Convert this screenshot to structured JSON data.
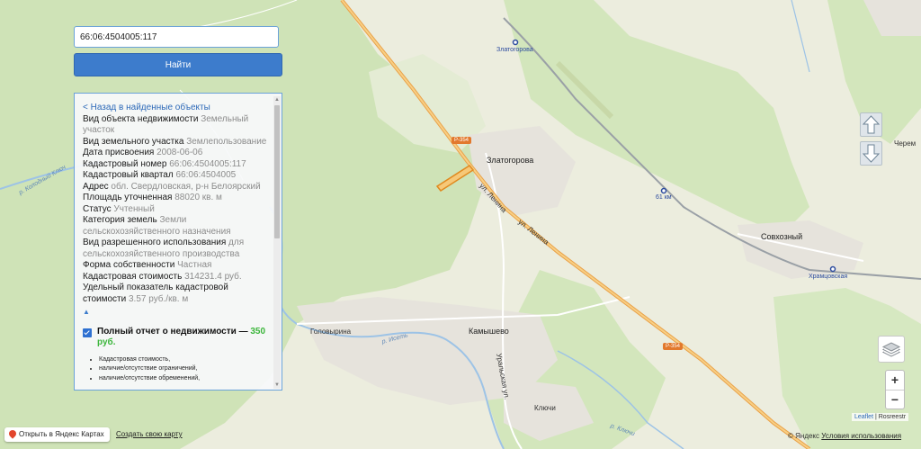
{
  "search": {
    "value": "66:06:4504005:117"
  },
  "find_button": {
    "label": "Найти"
  },
  "panel": {
    "back_link": "< Назад в найденные объекты",
    "fields": [
      {
        "key": "Вид объекта недвижимости",
        "value": "Земельный участок"
      },
      {
        "key": "Вид земельного участка",
        "value": "Землепользование"
      },
      {
        "key": "Дата присвоения",
        "value": "2008-06-06"
      },
      {
        "key": "Кадастровый номер",
        "value": "66:06:4504005:117"
      },
      {
        "key": "Кадастровый квартал",
        "value": "66:06:4504005"
      },
      {
        "key": "Адрес",
        "value": "обл. Свердловская, р-н Белоярский"
      },
      {
        "key": "Площадь уточненная",
        "value": "88020 кв. м"
      },
      {
        "key": "Статус",
        "value": "Учтенный"
      },
      {
        "key": "Категория земель",
        "value": "Земли сельскохозяйственного назначения"
      },
      {
        "key": "Вид разрешенного использования",
        "value": "для сельскохозяйственного производства"
      },
      {
        "key": "Форма собственности",
        "value": "Частная"
      },
      {
        "key": "Кадастровая стоимость",
        "value": "314231.4 руб."
      },
      {
        "key": "Удельный показатель кадастровой стоимости",
        "value": "3.57 руб./кв. м"
      }
    ],
    "collapse_glyph": "▲",
    "report": {
      "title": "Полный отчет о недвижимости — ",
      "price": "350 руб.",
      "items": [
        "Кадастровая стоимость,",
        "наличие/отсутствие ограничений,",
        "наличие/отсутствие обременений,"
      ]
    }
  },
  "map_labels": {
    "zlatogorova_station": "Златогорова",
    "zlatogorova": "Златогорова",
    "ulitsa_lenina_1": "ул. Ленина",
    "ulitsa_lenina_2": "ул. Ленина",
    "road_p354_1": "Р-354",
    "road_p354_2": "Р-354",
    "km61": "61 км",
    "sovkhozny": "Совхозный",
    "khramtsovskaya": "Храмцовская",
    "cherem": "Черем",
    "kamyshevo": "Камышево",
    "golovyrina": "Головырина",
    "klyuchi": "Ключи",
    "river_iset": "р. Исеть",
    "river_kolodny": "р. Колодный Ключ",
    "river_klyuchi": "р. Ключи",
    "street_k": "Уральская ул."
  },
  "attribution": {
    "leaflet": "Leaflet",
    "sep": " | ",
    "rosreestr": "Rosreestr"
  },
  "bottom": {
    "open_yandex": "Открыть в Яндекс Картах",
    "create_map": "Создать свою карту",
    "yandex": "© Яндекс",
    "terms": "Условия использования"
  },
  "zoom": {
    "in": "+",
    "out": "−"
  },
  "colors": {
    "accent": "#3d7ccc",
    "price": "#3cb63c",
    "road": "#f2b050",
    "forest": "#cfe3b7",
    "parcel": "#f0a030"
  }
}
